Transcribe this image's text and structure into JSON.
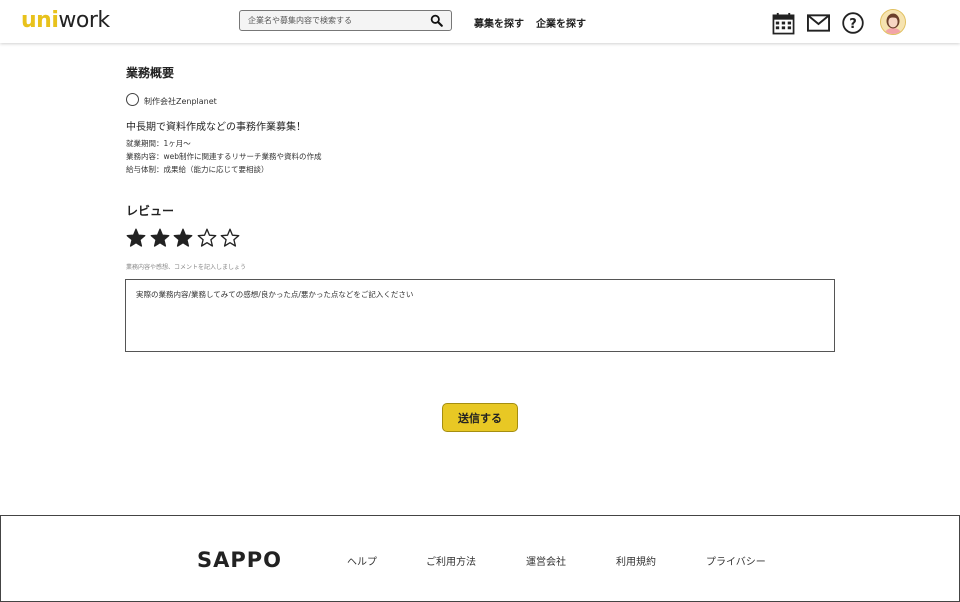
{
  "header": {
    "logo_part1": "uni",
    "logo_part2": "work",
    "search_placeholder": "企業名や募集内容で検索する",
    "nav": [
      "募集を探す",
      "企業を探す"
    ],
    "icons": [
      "calendar-icon",
      "mail-icon",
      "help-icon",
      "avatar"
    ]
  },
  "overview": {
    "heading": "業務概要",
    "company": "制作会社Zenplanet",
    "job_title": "中長期で資料作成などの事務作業募集！",
    "details": [
      "就業期間：1ヶ月〜",
      "業務内容：web制作に関連するリサーチ業務や資料の作成",
      "給与体制：成果給（能力に応じて要相談）"
    ]
  },
  "review": {
    "heading": "レビュー",
    "rating": 3,
    "max_rating": 5,
    "hint": "業務内容や感想、コメントを記入しましょう",
    "textarea_placeholder": "実際の業務内容/業務してみての感想/良かった点/悪かった点などをご記入ください",
    "submit_label": "送信する"
  },
  "footer": {
    "logo": "SAPPO",
    "links": [
      "ヘルプ",
      "ご利用方法",
      "運営会社",
      "利用規約",
      "プライバシー"
    ]
  },
  "colors": {
    "accent": "#e8c824",
    "logo_accent": "#e8c21c",
    "text": "#222222"
  }
}
